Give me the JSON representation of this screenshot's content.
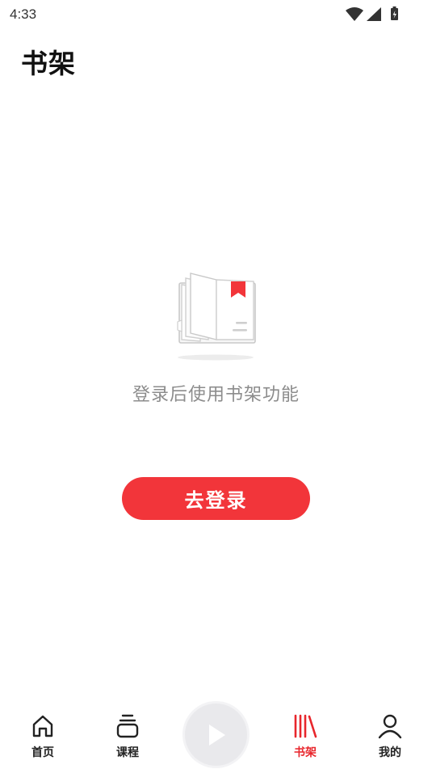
{
  "status_bar": {
    "time": "4:33",
    "icons": [
      "wifi-icon",
      "cellular-signal-icon",
      "battery-charging-icon"
    ]
  },
  "page": {
    "title": "书架"
  },
  "empty_state": {
    "icon": "open-book-bookmark-icon",
    "message": "登录后使用书架功能"
  },
  "login_button": {
    "label": "去登录",
    "color": "#f2353a"
  },
  "bottom_nav": {
    "accent_color": "#e8262c",
    "items": [
      {
        "label": "首页",
        "icon": "home-icon",
        "active": false
      },
      {
        "label": "课程",
        "icon": "course-stack-icon",
        "active": false
      },
      {
        "label": "书架",
        "icon": "bookshelf-icon",
        "active": true
      },
      {
        "label": "我的",
        "icon": "profile-icon",
        "active": false
      }
    ],
    "center_button": {
      "icon": "play-icon"
    }
  }
}
